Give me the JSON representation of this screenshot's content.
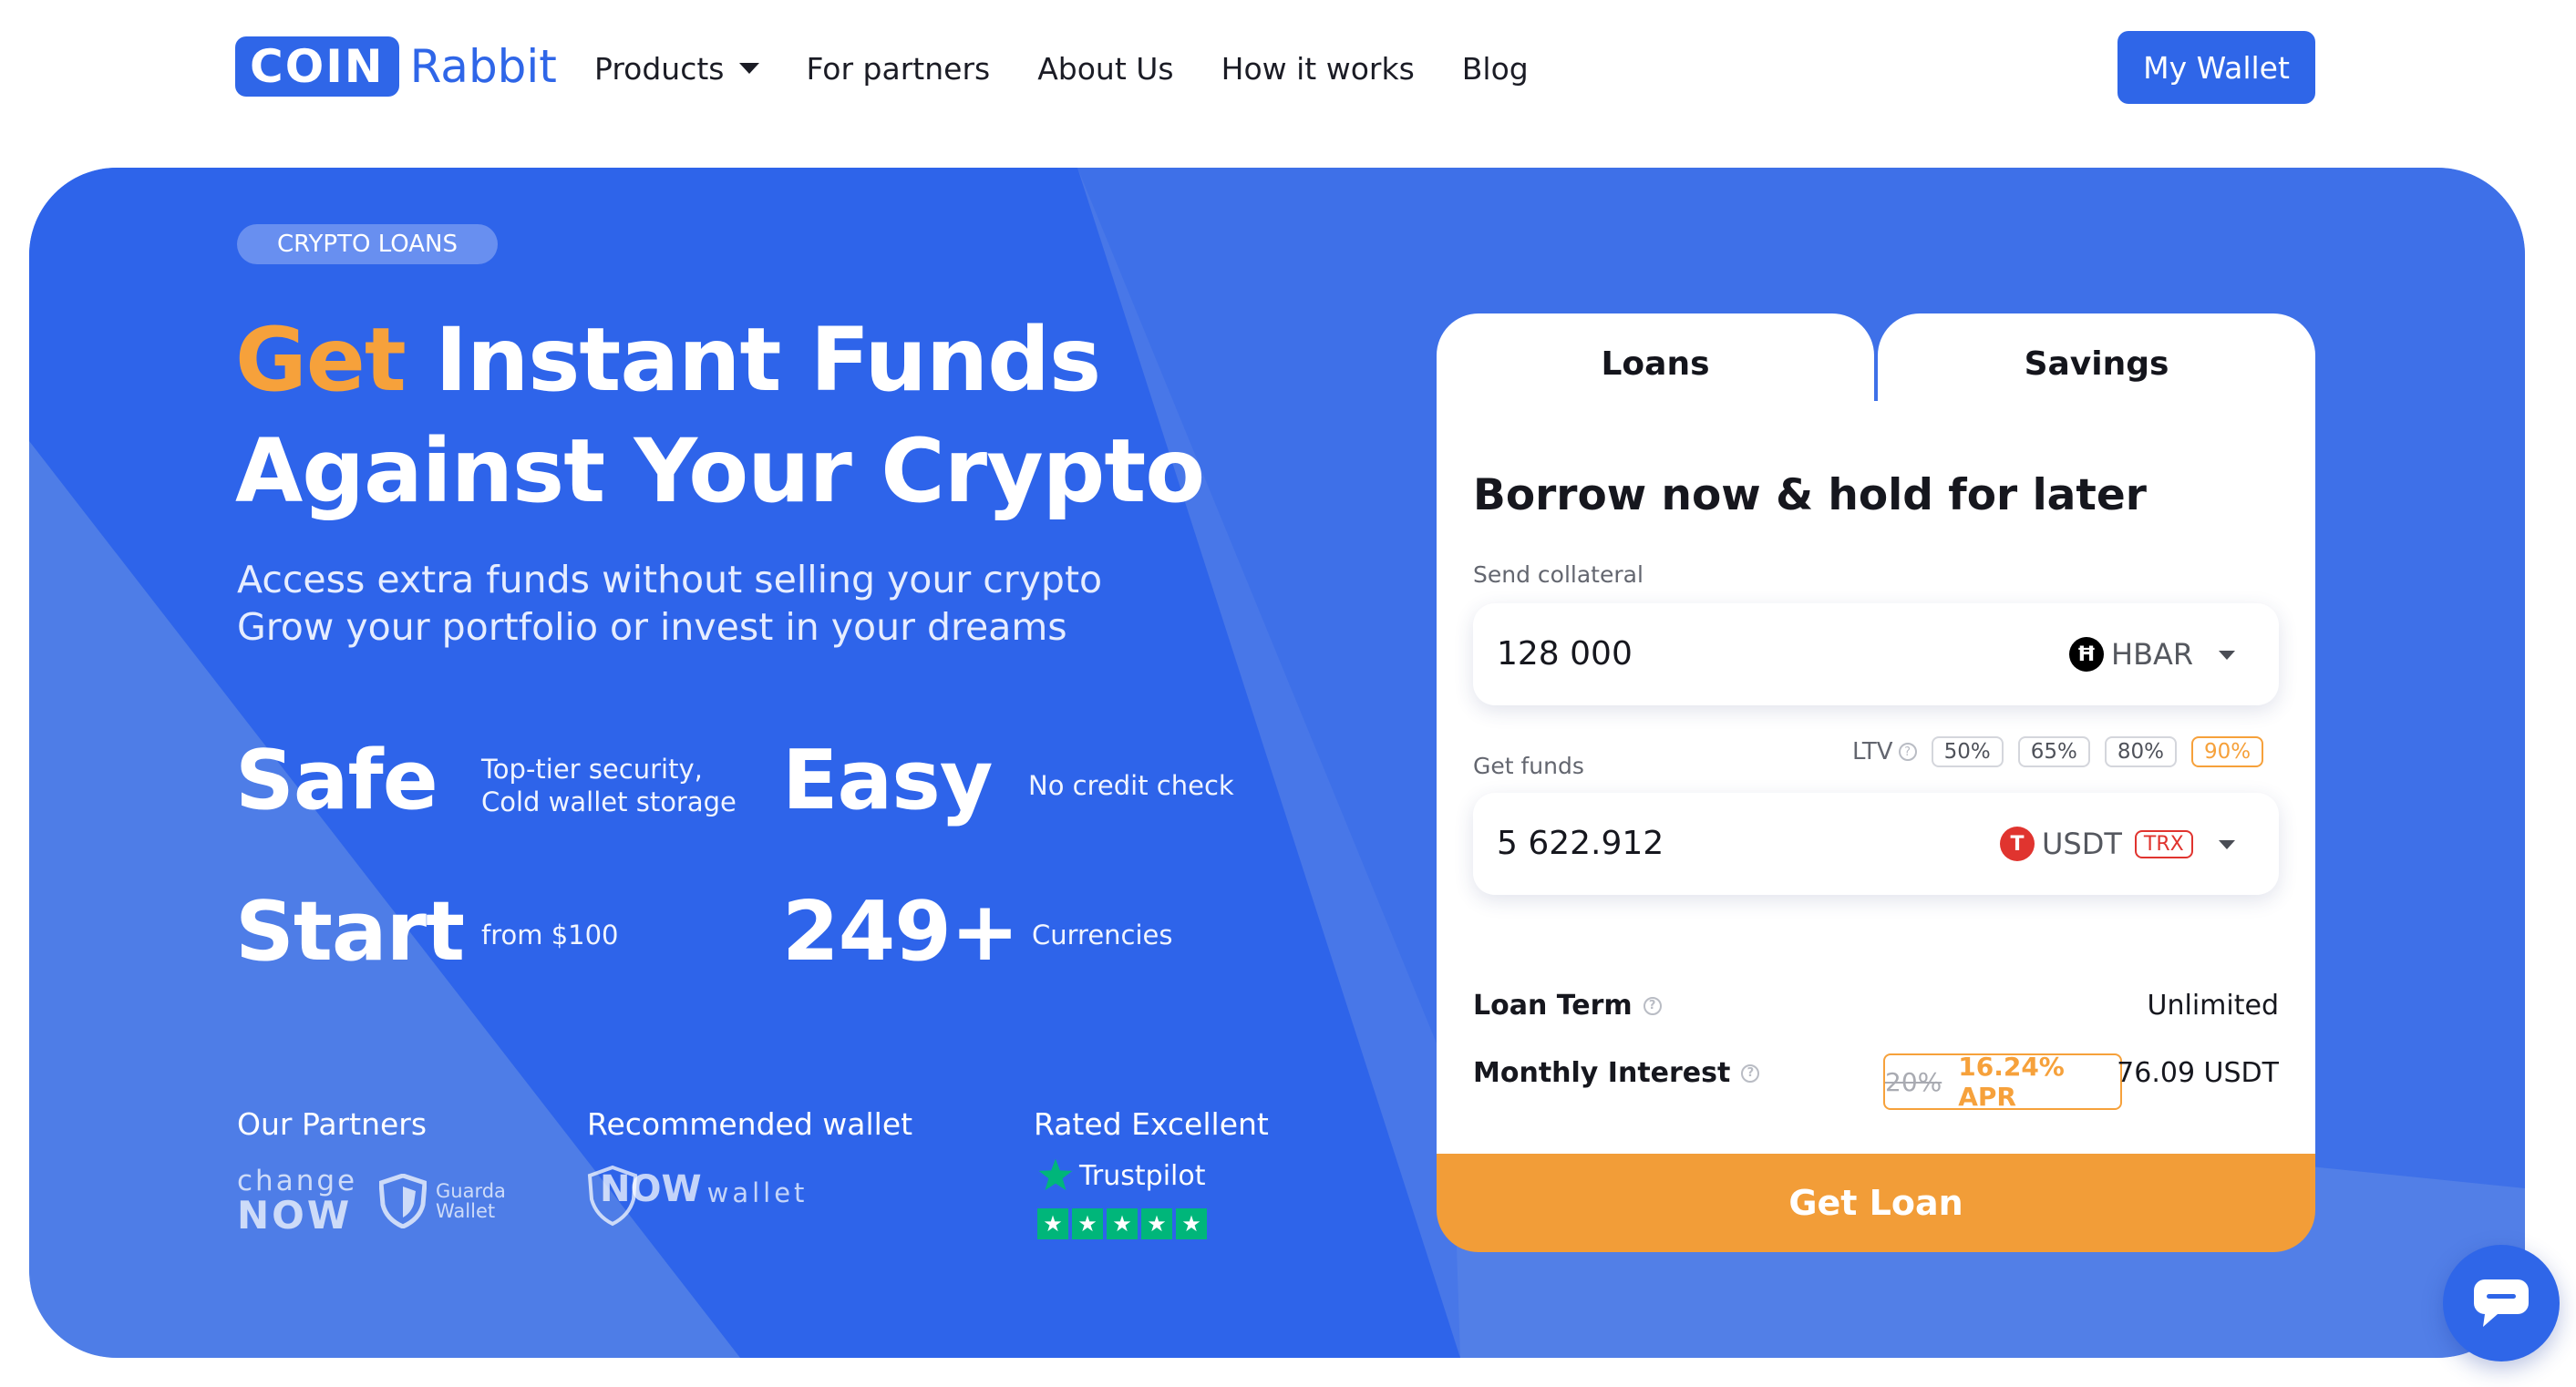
{
  "header": {
    "logo_box": "COIN",
    "logo_text": "Rabbit",
    "nav": [
      {
        "label": "Products"
      },
      {
        "label": "For partners"
      },
      {
        "label": "About Us"
      },
      {
        "label": "How it works"
      },
      {
        "label": "Blog"
      }
    ],
    "wallet_button": "My Wallet"
  },
  "hero": {
    "badge": "CRYPTO LOANS",
    "title_accent": "Get",
    "title_rest": " Instant Funds",
    "title_line2": "Against Your Crypto",
    "subtitle_line1": "Access extra funds without selling your crypto",
    "subtitle_line2": "Grow your portfolio or invest in your dreams",
    "stats": [
      {
        "big": "Safe",
        "small_line1": "Top-tier security,",
        "small_line2": "Cold wallet storage"
      },
      {
        "big": "Easy",
        "small_line1": "No credit check"
      },
      {
        "big": "Start",
        "small_line1": "from $100"
      },
      {
        "big": "249+",
        "small_line1": "Currencies"
      }
    ],
    "partners_title": "Our Partners",
    "partners": {
      "change_top": "change",
      "change_bottom": "NOW",
      "guarda_line1": "Guarda",
      "guarda_line2": "Wallet"
    },
    "wallet_title": "Recommended wallet",
    "wallet_logo_bold": "NOW",
    "wallet_logo_light": "wallet",
    "rated_title": "Rated Excellent",
    "trustpilot": "Trustpilot",
    "stars": 5
  },
  "card": {
    "tabs": [
      "Loans",
      "Savings"
    ],
    "active_tab": "Loans",
    "title": "Borrow now & hold for later",
    "send_label": "Send collateral",
    "send_value": "128 000",
    "send_coin": "HBAR",
    "get_label": "Get funds",
    "get_value": "5 622.912",
    "get_coin": "USDT",
    "get_network": "TRX",
    "ltv_label": "LTV",
    "ltv_options": [
      "50%",
      "65%",
      "80%",
      "90%"
    ],
    "ltv_selected": "90%",
    "loan_term_label": "Loan Term",
    "loan_term_value": "Unlimited",
    "interest_label": "Monthly Interest",
    "interest_old": "20%",
    "interest_apr": "16.24% APR",
    "interest_value": "76.09 USDT",
    "cta": "Get Loan"
  },
  "colors": {
    "brand": "#2f66e8",
    "accent": "#f6a13b",
    "hero_bg": "#4877e8",
    "tether": "#e0342f"
  },
  "icons": {
    "hbar": "hbar-coin-icon",
    "usdt": "tether-coin-icon",
    "chat": "chat-bubble-icon",
    "star": "trustpilot-star-icon"
  }
}
